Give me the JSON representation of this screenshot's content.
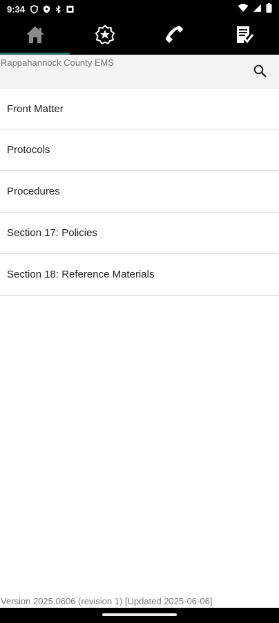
{
  "status_bar": {
    "time": "9:34"
  },
  "tabs": [
    {
      "name": "home",
      "icon": "home-icon"
    },
    {
      "name": "favorites",
      "icon": "star-badge-icon"
    },
    {
      "name": "contacts",
      "icon": "phone-icon"
    },
    {
      "name": "checklist",
      "icon": "checklist-icon"
    }
  ],
  "header": {
    "org": "Rappahannock County EMS",
    "search_icon": "search-icon"
  },
  "menu": [
    {
      "label": "Front Matter"
    },
    {
      "label": "Protocols"
    },
    {
      "label": "Procedures"
    },
    {
      "label": "Section 17: Policies"
    },
    {
      "label": "Section 18: Reference Materials"
    }
  ],
  "footer": {
    "version": "Version 2025.0606 (revision 1) [Updated 2025-06-06]"
  },
  "colors": {
    "active_tab_indicator": "#2a6b63",
    "header_bg": "#f4f4f4"
  }
}
